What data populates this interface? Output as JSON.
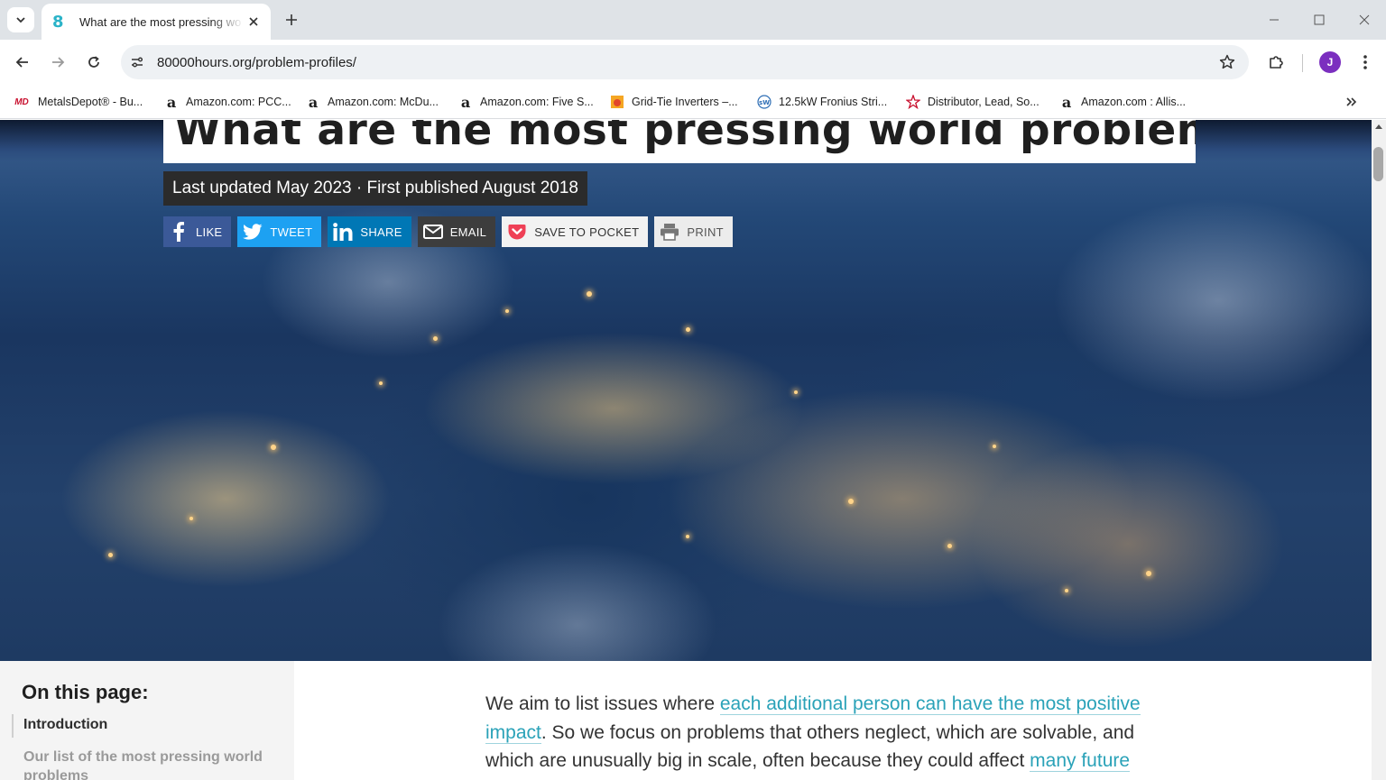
{
  "browser": {
    "tab": {
      "title": "What are the most pressing wo",
      "favicon": "8"
    },
    "url": "80000hours.org/problem-profiles/",
    "profile_initial": "J",
    "icons": {
      "tab_search": "chevron-down-icon",
      "back": "arrow-left-icon",
      "forward": "arrow-right-icon",
      "reload": "reload-icon",
      "site_info": "tune-icon",
      "bookmark_star": "star-icon",
      "extensions": "puzzle-icon",
      "menu": "kebab-menu-icon"
    }
  },
  "bookmarks": [
    {
      "label": "MetalsDepot® - Bu...",
      "icon": "MD",
      "color": "#c8102e"
    },
    {
      "label": "Amazon.com: PCC...",
      "icon": "a",
      "color": "#111111"
    },
    {
      "label": "Amazon.com: McDu...",
      "icon": "a",
      "color": "#111111"
    },
    {
      "label": "Amazon.com: Five S...",
      "icon": "a",
      "color": "#111111"
    },
    {
      "label": "Grid-Tie Inverters –...",
      "icon": "sun",
      "color": "#f5a623"
    },
    {
      "label": "12.5kW Fronius Stri...",
      "icon": "sW",
      "color": "#2f6fb5"
    },
    {
      "label": "Distributor, Lead, So...",
      "icon": "star",
      "color": "#c8102e"
    },
    {
      "label": "Amazon.com : Allis...",
      "icon": "a",
      "color": "#111111"
    }
  ],
  "page": {
    "title": "What are the most pressing world problems?",
    "updated": "Last updated May 2023 · First published August 2018",
    "share": {
      "like": "LIKE",
      "tweet": "TWEET",
      "share": "SHARE",
      "email": "EMAIL",
      "pocket": "SAVE TO POCKET",
      "print": "PRINT"
    },
    "toc": {
      "title": "On this page:",
      "items": [
        "Introduction",
        "Our list of the most pressing world problems"
      ]
    },
    "intro": {
      "t1": "We aim to list issues where ",
      "link1": "each additional person can have the most positive impact",
      "t2": ". So we focus on problems that others neglect, which are solvable, and which are unusually big in scale, often because they could affect ",
      "link2": "many future"
    }
  },
  "colors": {
    "accent_link": "#2aa2b8",
    "facebook": "#3b5998",
    "twitter": "#1da1f2",
    "linkedin": "#0077b5",
    "pocket_red": "#ef4056"
  }
}
